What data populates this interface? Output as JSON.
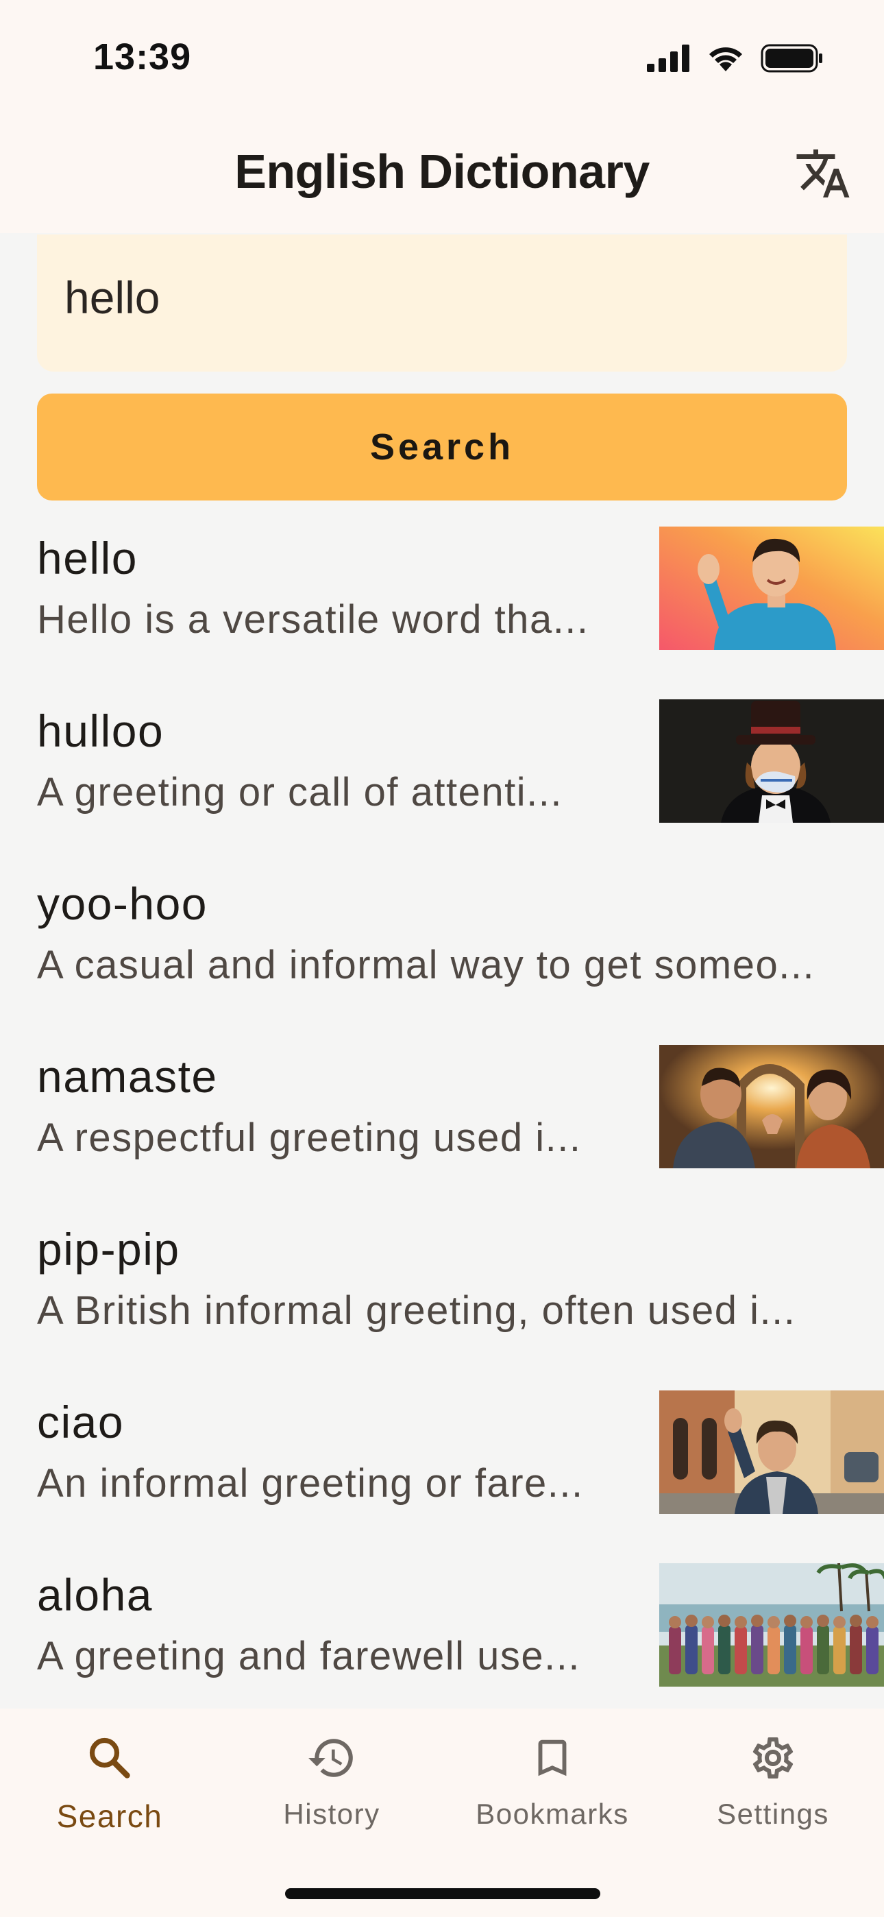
{
  "status_bar": {
    "time": "13:39"
  },
  "app_bar": {
    "title": "English Dictionary",
    "action_icon": "translate-icon"
  },
  "search": {
    "value": "hello",
    "button_label": "Search"
  },
  "results": [
    {
      "word": "hello",
      "definition": "Hello is a versatile word tha...",
      "thumbnail": "man-waving-blue-sweater"
    },
    {
      "word": "hulloo",
      "definition": "A greeting or call of attenti...",
      "thumbnail": "man-top-hat-teacup"
    },
    {
      "word": "yoo-hoo",
      "definition": "A casual and informal way to get someo...",
      "thumbnail": null
    },
    {
      "word": "namaste",
      "definition": "A respectful greeting used i...",
      "thumbnail": "couple-namaste-temple"
    },
    {
      "word": "pip-pip",
      "definition": "A British informal greeting, often used i...",
      "thumbnail": null
    },
    {
      "word": "ciao",
      "definition": "An informal greeting or fare...",
      "thumbnail": "man-waving-italian-street"
    },
    {
      "word": "aloha",
      "definition": "A greeting and farewell use...",
      "thumbnail": "group-with-leis-beach"
    }
  ],
  "bottom_nav": [
    {
      "label": "Search",
      "icon": "search-icon",
      "active": true
    },
    {
      "label": "History",
      "icon": "history-icon",
      "active": false
    },
    {
      "label": "Bookmarks",
      "icon": "bookmark-icon",
      "active": false
    },
    {
      "label": "Settings",
      "icon": "gear-icon",
      "active": false
    }
  ],
  "colors": {
    "accent": "#FEB94F",
    "search_field_bg": "#FEF3DF",
    "active_nav": "#7A4A12",
    "surface": "#FDF7F3",
    "background": "#F5F5F4"
  }
}
